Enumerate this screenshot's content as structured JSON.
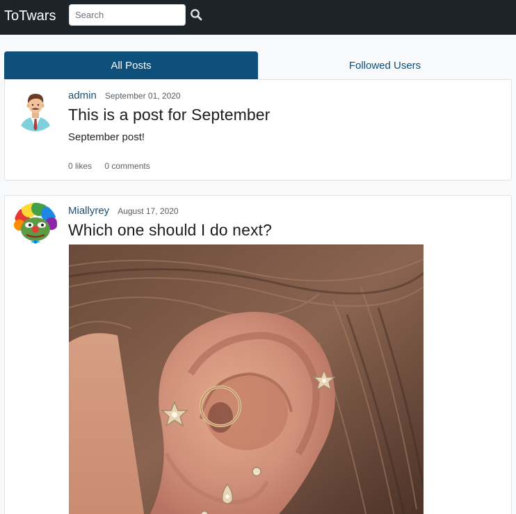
{
  "nav": {
    "brand": "ToTwars",
    "search_placeholder": "Search"
  },
  "tabs": [
    {
      "label": "All Posts",
      "active": true
    },
    {
      "label": "Followed Users",
      "active": false
    }
  ],
  "posts": [
    {
      "author": "admin",
      "date": "September 01, 2020",
      "title": "This is a post for September",
      "body": "September post!",
      "likes": "0 likes",
      "comments": "0 comments",
      "avatar_icon": "man-avatar-icon"
    },
    {
      "author": "Miallyrey",
      "date": "August 17, 2020",
      "title": "Which one should I do next?",
      "avatar_icon": "clown-frog-avatar-icon",
      "image": "ear-piercings-photo"
    }
  ],
  "colors": {
    "navbar": "#1c2329",
    "accent": "#0e4f7b",
    "background": "#f8f9fa"
  }
}
